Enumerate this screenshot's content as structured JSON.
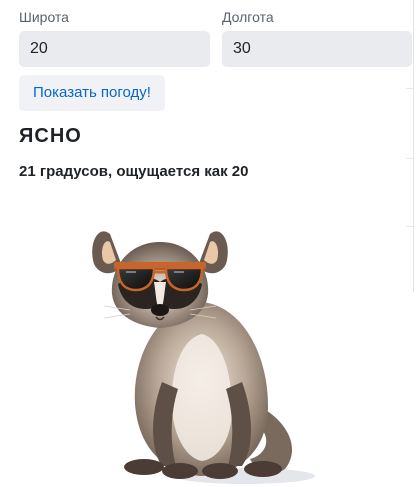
{
  "form": {
    "latitude_label": "Широта",
    "latitude_value": "20",
    "longitude_label": "Долгота",
    "longitude_value": "30",
    "submit_label": "Показать погоду!"
  },
  "weather": {
    "condition": "ЯСНО",
    "temperature_text": "21 градусов, ощущается как 20"
  },
  "image": {
    "icon": "raccoon-with-sunglasses"
  }
}
